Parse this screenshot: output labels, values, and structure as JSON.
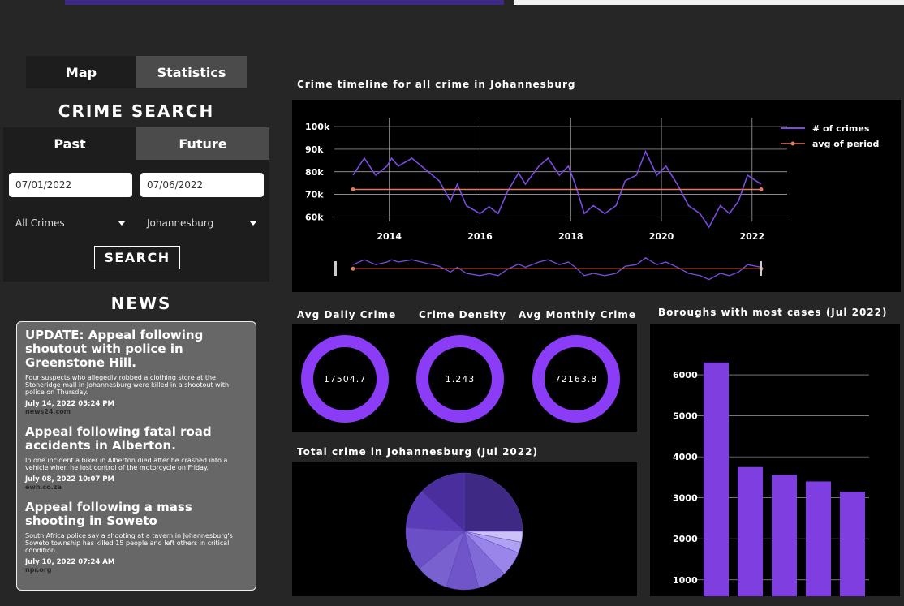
{
  "view_tabs": {
    "map": "Map",
    "statistics": "Statistics"
  },
  "search": {
    "title": "CRIME SEARCH",
    "tab_past": "Past",
    "tab_future": "Future",
    "start_date": "07/01/2022",
    "end_date": "07/06/2022",
    "crime_type": "All Crimes",
    "city": "Johannesburg",
    "button": "SEARCH"
  },
  "news": {
    "title": "NEWS",
    "items": [
      {
        "headline": "UPDATE: Appeal following shoutout with police in Greenstone Hill.",
        "body": "Four suspects who allegedly robbed a clothing store at the Stoneridge mall in Johannesburg were killed in a shootout with police on Thursday.",
        "date": "July 14, 2022 05:24 PM",
        "source": "news24.com"
      },
      {
        "headline": "Appeal following fatal road accidents in Alberton.",
        "body": "In one incident a biker in Alberton died after he crashed into a vehicle when he lost control of the motorcycle on Friday.",
        "date": "July 08, 2022 10:07 PM",
        "source": "ewn.co.za"
      },
      {
        "headline": "Appeal following a mass shooting in Soweto",
        "body": "South Africa police say a shooting at a tavern in Johannesburg's Soweto township has killed 15 people and left others in critical condition.",
        "date": "July 10, 2022 07:24 AM",
        "source": "npr.org"
      }
    ]
  },
  "metrics": {
    "avg_daily_label": "Avg Daily Crime",
    "avg_daily_value": "17504.7",
    "density_label": "Crime Density",
    "density_value": "1.243",
    "avg_monthly_label": "Avg Monthly Crime",
    "avg_monthly_value": "72163.8"
  },
  "colors": {
    "accent": "#8b3cf7",
    "line": "#7b4ae0",
    "avg": "#e07a5f",
    "bar": "#7f3fe0"
  },
  "chart_data": [
    {
      "type": "line",
      "title": "Crime timeline for all crime in Johannesburg",
      "xlim": [
        2013.2,
        2022.2
      ],
      "ylim": [
        58000,
        104000
      ],
      "x_ticks": [
        2014,
        2016,
        2018,
        2020,
        2022
      ],
      "y_ticks": [
        60000,
        70000,
        80000,
        90000,
        100000
      ],
      "y_tick_labels": [
        "60k",
        "70k",
        "80k",
        "90k",
        "100k"
      ],
      "grid": true,
      "legend_position": "right",
      "series": [
        {
          "name": "# of crimes",
          "x": [
            2013.2,
            2013.45,
            2013.7,
            2013.95,
            2014.05,
            2014.2,
            2014.5,
            2014.8,
            2015.1,
            2015.35,
            2015.5,
            2015.7,
            2016.0,
            2016.2,
            2016.4,
            2016.6,
            2016.85,
            2017.0,
            2017.3,
            2017.5,
            2017.75,
            2017.95,
            2018.1,
            2018.3,
            2018.5,
            2018.75,
            2019.0,
            2019.2,
            2019.45,
            2019.65,
            2019.9,
            2020.1,
            2020.35,
            2020.6,
            2020.85,
            2021.05,
            2021.3,
            2021.5,
            2021.7,
            2021.9,
            2022.05,
            2022.2
          ],
          "y": [
            78500,
            86000,
            78500,
            82500,
            86000,
            82500,
            86000,
            81000,
            76000,
            67000,
            74500,
            65000,
            61500,
            64500,
            61500,
            71000,
            79500,
            74500,
            82500,
            86000,
            78500,
            82500,
            74500,
            61500,
            65000,
            61500,
            65000,
            76000,
            78500,
            89000,
            78500,
            82500,
            74500,
            65000,
            61500,
            55500,
            65000,
            61500,
            67000,
            78500,
            76500,
            74500
          ]
        },
        {
          "name": "avg of period",
          "x": [
            2013.2,
            2022.2
          ],
          "y": [
            72200,
            72200
          ]
        }
      ]
    },
    {
      "type": "pie",
      "title": "Total crime in Johannesburg (Jul 2022)",
      "values": [
        25,
        3,
        3,
        7,
        8,
        9,
        9,
        12,
        11,
        13
      ],
      "colors": [
        "#3e2a85",
        "#ccc2f8",
        "#b0a2f2",
        "#9a86ea",
        "#806ad8",
        "#6f55c9",
        "#7a61d0",
        "#6a4fc7",
        "#5a3cb8",
        "#4a2e9e"
      ]
    },
    {
      "type": "bar",
      "title": "Boroughs with most cases (Jul 2022)",
      "categories": [
        "",
        "",
        "",
        "",
        ""
      ],
      "values": [
        6300,
        3750,
        3560,
        3400,
        3150
      ],
      "ylim": [
        600,
        6950
      ],
      "y_ticks": [
        1000,
        2000,
        3000,
        4000,
        5000,
        6000
      ],
      "grid": true
    }
  ]
}
